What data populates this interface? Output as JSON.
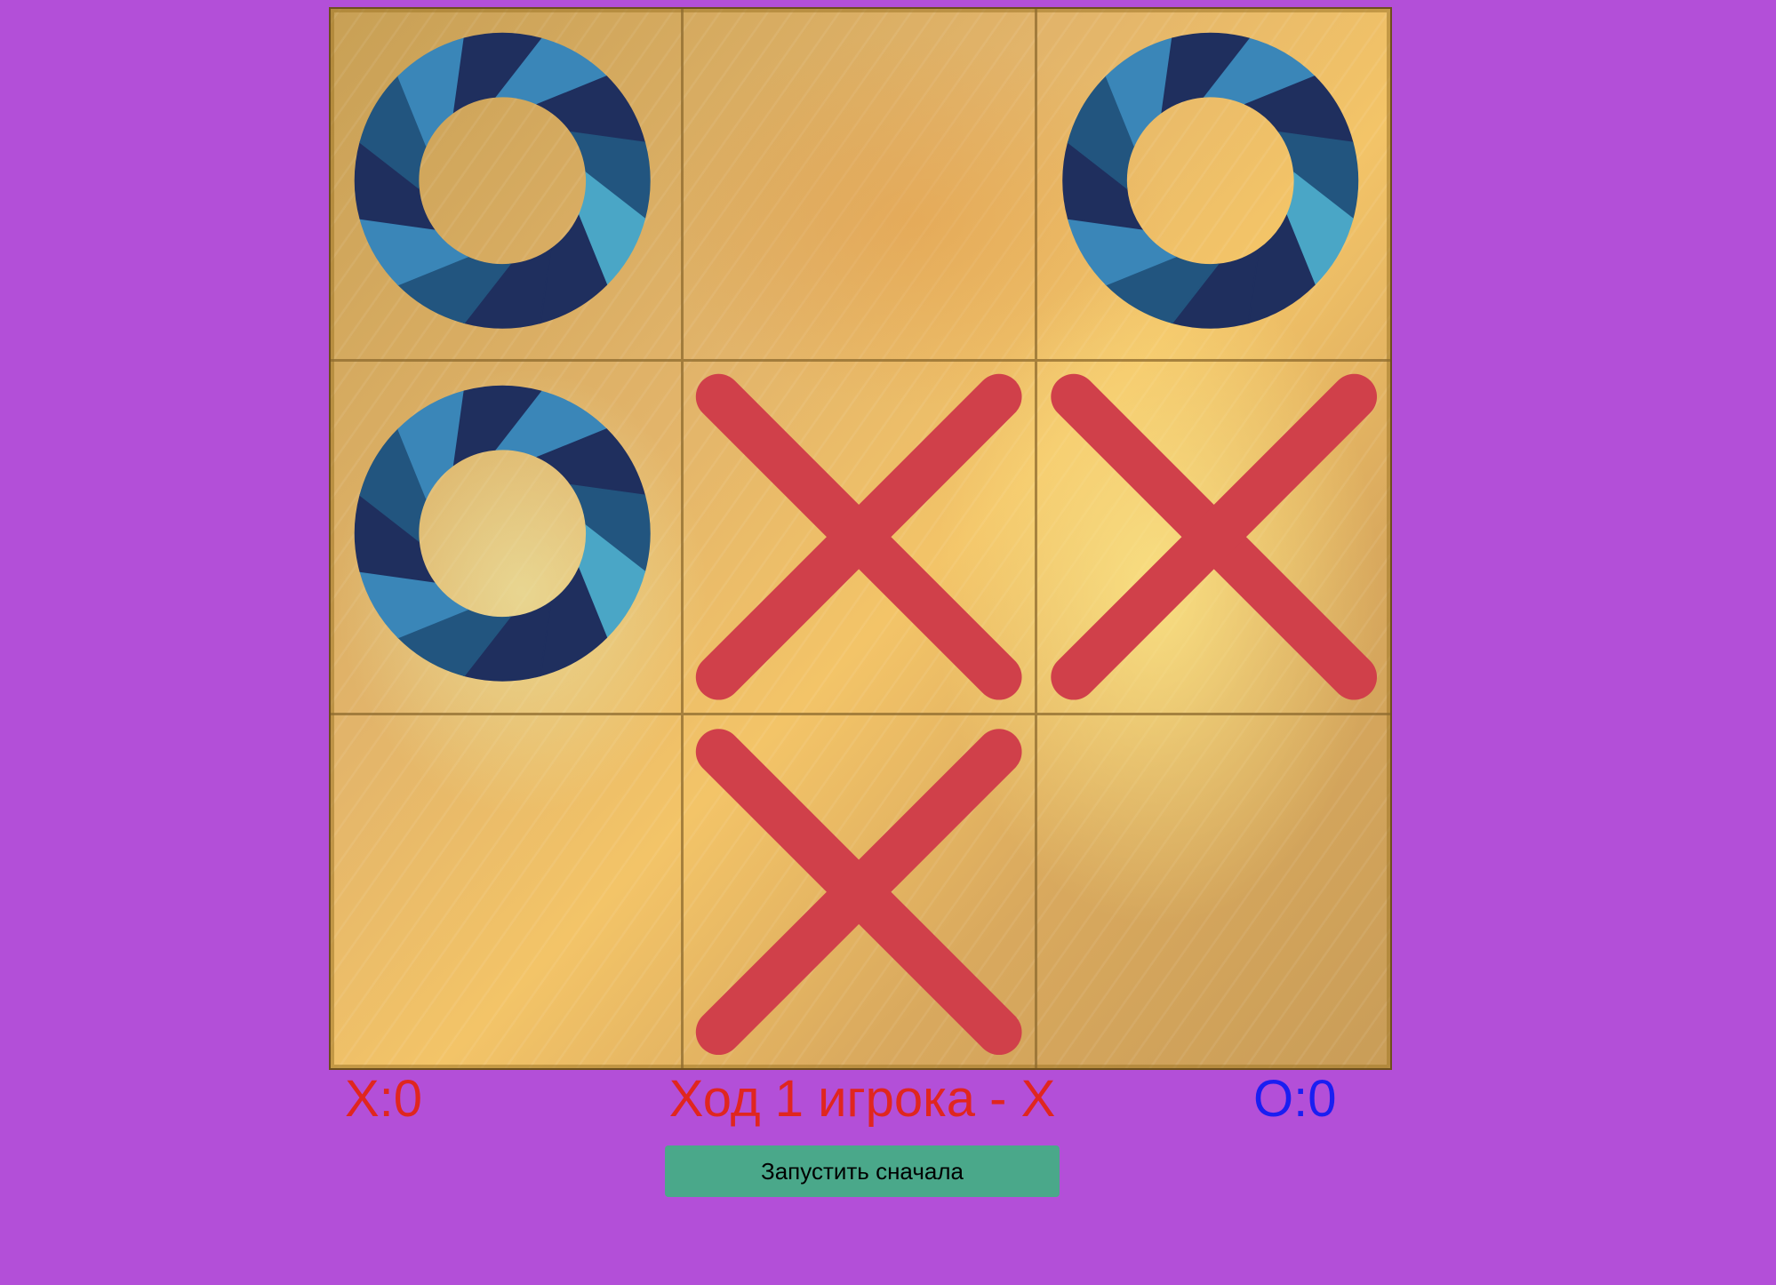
{
  "board": {
    "cells": [
      [
        "O",
        "",
        "O"
      ],
      [
        "O",
        "X",
        "X"
      ],
      [
        "",
        "X",
        ""
      ]
    ],
    "x_color": "#d0404a",
    "o_colors": [
      "#1f2f5e",
      "#22557f",
      "#3a86b8",
      "#4aa6c6"
    ]
  },
  "score": {
    "x_text": "X:0",
    "o_text": "O:0",
    "x_color": "#e0261f",
    "o_color": "#1a1ef2"
  },
  "status": {
    "turn_text": "Ход 1 игрока - X",
    "color": "#e0261f"
  },
  "controls": {
    "restart_label": "Запустить сначала",
    "restart_color": "#4aa88a"
  },
  "icons": {
    "x_mark": "x-mark-icon",
    "o_mark": "o-ring-icon"
  }
}
